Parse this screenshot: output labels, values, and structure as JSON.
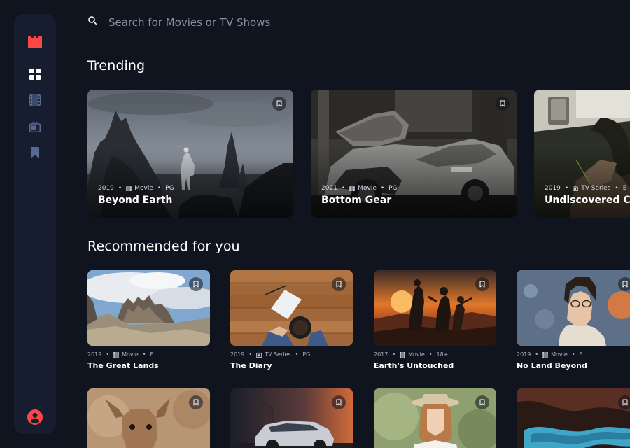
{
  "search": {
    "placeholder": "Search for Movies or TV Shows"
  },
  "sections": {
    "trending": "Trending",
    "recommended": "Recommended for you"
  },
  "colors": {
    "accent": "#fc4747",
    "background": "#10141e",
    "sidebar": "#161d2f",
    "nav_active": "#ffffff",
    "nav_inactive": "#5a698f"
  },
  "nav": {
    "logo": "clapperboard-icon",
    "items": [
      {
        "icon": "grid-icon",
        "active": true
      },
      {
        "icon": "film-icon",
        "active": false
      },
      {
        "icon": "tv-icon",
        "active": false
      },
      {
        "icon": "bookmark-icon",
        "active": false
      }
    ],
    "profile": "user-icon"
  },
  "trending": [
    {
      "year": "2019",
      "category": "Movie",
      "rating": "PG",
      "title": "Beyond Earth"
    },
    {
      "year": "2021",
      "category": "Movie",
      "rating": "PG",
      "title": "Bottom Gear"
    },
    {
      "year": "2019",
      "category": "TV Series",
      "rating": "E",
      "title": "Undiscovered Cities"
    }
  ],
  "recommended": [
    {
      "year": "2019",
      "category": "Movie",
      "rating": "E",
      "title": "The Great Lands"
    },
    {
      "year": "2019",
      "category": "TV Series",
      "rating": "PG",
      "title": "The Diary"
    },
    {
      "year": "2017",
      "category": "Movie",
      "rating": "18+",
      "title": "Earth's Untouched"
    },
    {
      "year": "2019",
      "category": "Movie",
      "rating": "E",
      "title": "No Land Beyond"
    }
  ]
}
